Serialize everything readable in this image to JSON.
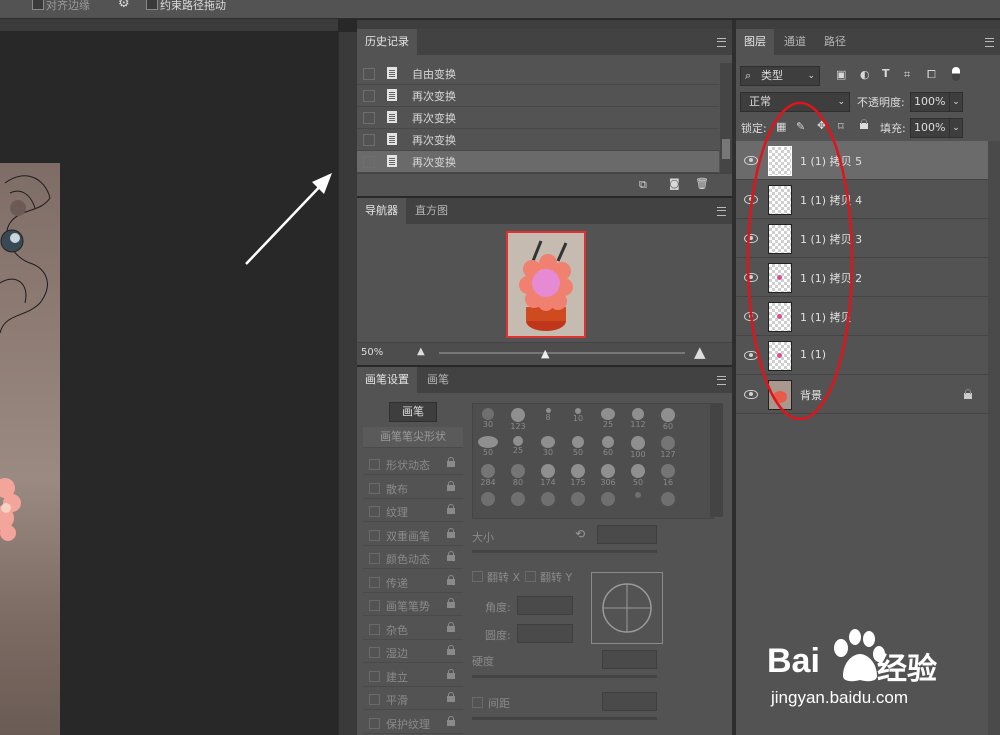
{
  "options_bar": {
    "align_edges": "对齐边缘",
    "constrain_path": "约束路径拖动"
  },
  "history": {
    "tab": "历史记录",
    "items": [
      {
        "label": "自由变换"
      },
      {
        "label": "再次变换"
      },
      {
        "label": "再次变换"
      },
      {
        "label": "再次变换"
      },
      {
        "label": "再次变换"
      }
    ]
  },
  "navigator": {
    "tabs": [
      "导航器",
      "直方图"
    ],
    "zoom": "50%"
  },
  "brush_settings": {
    "tabs": [
      "画笔设置",
      "画笔"
    ],
    "brush_button": "画笔",
    "tip_shape": "画笔笔尖形状",
    "options": [
      "形状动态",
      "散布",
      "纹理",
      "双重画笔",
      "颜色动态",
      "传递",
      "画笔笔势",
      "杂色",
      "湿边",
      "建立",
      "平滑",
      "保护纹理"
    ],
    "tip_sizes": [
      "30",
      "123",
      "8",
      "10",
      "25",
      "112",
      "60",
      "50",
      "25",
      "30",
      "50",
      "60",
      "100",
      "127",
      "284",
      "80",
      "174",
      "175",
      "306",
      "50",
      "16"
    ],
    "size_label": "大小",
    "flip_x": "翻转 X",
    "flip_y": "翻转 Y",
    "angle_label": "角度:",
    "roundness_label": "圆度:",
    "hardness_label": "硬度",
    "spacing_label": "间距"
  },
  "layers": {
    "tabs": [
      "图层",
      "通道",
      "路径"
    ],
    "filter_kind": "类型",
    "blend_mode": "正常",
    "opacity_label": "不透明度:",
    "opacity_value": "100%",
    "lock_label": "锁定:",
    "fill_label": "填充:",
    "fill_value": "100%",
    "items": [
      {
        "name": "1 (1) 拷贝 5",
        "selected": true
      },
      {
        "name": "1 (1) 拷贝 4"
      },
      {
        "name": "1 (1) 拷贝 3"
      },
      {
        "name": "1 (1) 拷贝 2"
      },
      {
        "name": "1 (1) 拷贝"
      },
      {
        "name": "1 (1)"
      },
      {
        "name": "背景",
        "locked": true
      }
    ]
  },
  "watermark": {
    "brand": "Bai",
    "brand_cn": "经验",
    "url": "jingyan.baidu.com"
  },
  "colors": {
    "annotation_red": "#e0141b",
    "panel_bg": "#535353",
    "canvas_bg": "#282828"
  }
}
